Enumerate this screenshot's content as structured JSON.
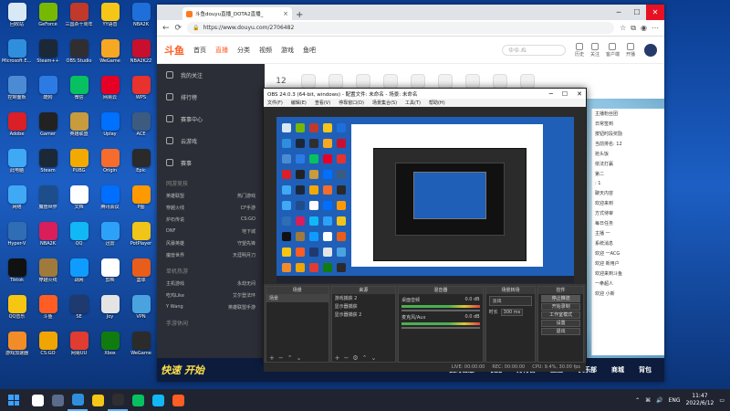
{
  "desktop": {
    "icons": [
      {
        "label": "回收站",
        "color": "#d9e8f5"
      },
      {
        "label": "GeForce",
        "color": "#76b900"
      },
      {
        "label": "三国杀十周年",
        "color": "#c0392b"
      },
      {
        "label": "YY语音",
        "color": "#f5c518"
      },
      {
        "label": "NBA2K",
        "color": "#1e6fd9"
      },
      {
        "label": "Microsoft Edge",
        "color": "#2f8fdc"
      },
      {
        "label": "Steam++",
        "color": "#1b2838"
      },
      {
        "label": "OBS Studio",
        "color": "#302e31"
      },
      {
        "label": "WeGame",
        "color": "#f7a823"
      },
      {
        "label": "NBA2K22",
        "color": "#c8102e"
      },
      {
        "label": "控制面板",
        "color": "#4b8bd4"
      },
      {
        "label": "酷狗",
        "color": "#2c7be5"
      },
      {
        "label": "微信",
        "color": "#07c160"
      },
      {
        "label": "网易云",
        "color": "#e60026"
      },
      {
        "label": "WPS",
        "color": "#e8322d"
      },
      {
        "label": "Adobe",
        "color": "#da1f26"
      },
      {
        "label": "Gamer",
        "color": "#222"
      },
      {
        "label": "英雄联盟",
        "color": "#c89b3c"
      },
      {
        "label": "Uplay",
        "color": "#0070ff"
      },
      {
        "label": "ACE",
        "color": "#3d5a80"
      },
      {
        "label": "此电脑",
        "color": "#3fa9f5"
      },
      {
        "label": "Steam",
        "color": "#1b2838"
      },
      {
        "label": "PUBG",
        "color": "#f2a900"
      },
      {
        "label": "Origin",
        "color": "#f56c2d"
      },
      {
        "label": "Epic",
        "color": "#2a2a2a"
      },
      {
        "label": "网络",
        "color": "#3fa9f5"
      },
      {
        "label": "魔兽世界",
        "color": "#1e4d8b"
      },
      {
        "label": "文档",
        "color": "#ffffff"
      },
      {
        "label": "腾讯会议",
        "color": "#006eff"
      },
      {
        "label": "P图",
        "color": "#ff9900"
      },
      {
        "label": "Hyper-V",
        "color": "#2f6db5"
      },
      {
        "label": "NBA2K",
        "color": "#d81e5b"
      },
      {
        "label": "QQ",
        "color": "#12b7f5"
      },
      {
        "label": "迅雷",
        "color": "#2da1f8"
      },
      {
        "label": "PotPlayer",
        "color": "#f0c419"
      },
      {
        "label": "Tiktok",
        "color": "#111"
      },
      {
        "label": "穿越火线",
        "color": "#a07a3a"
      },
      {
        "label": "战网",
        "color": "#0f9cff"
      },
      {
        "label": "剪映",
        "color": "#ffffff"
      },
      {
        "label": "篮球",
        "color": "#e95d1a"
      },
      {
        "label": "QQ音乐",
        "color": "#f7c613"
      },
      {
        "label": "斗鱼",
        "color": "#ff5d23"
      },
      {
        "label": "SE",
        "color": "#1e3a6e"
      },
      {
        "label": "Joy",
        "color": "#e4e4e4"
      },
      {
        "label": "VPN",
        "color": "#4aa3df"
      },
      {
        "label": "游戏加速器",
        "color": "#f28c28"
      },
      {
        "label": "CS:GO",
        "color": "#f0a500"
      },
      {
        "label": "网易UU",
        "color": "#e03c31"
      },
      {
        "label": "Xbox",
        "color": "#107c10"
      },
      {
        "label": "WeGame",
        "color": "#2b2b2b"
      }
    ]
  },
  "taskbar": {
    "clock_time": "11:47",
    "clock_date": "2022/6/12",
    "lang": "ENG",
    "apps": [
      {
        "name": "search-app",
        "color": "#ffffff"
      },
      {
        "name": "taskview-app",
        "color": "#5a6b8c"
      },
      {
        "name": "edge-app",
        "color": "#2f8fdc"
      },
      {
        "name": "explorer-app",
        "color": "#f5c518"
      },
      {
        "name": "obs-app",
        "color": "#302e31"
      },
      {
        "name": "wechat-app",
        "color": "#07c160"
      },
      {
        "name": "qq-app",
        "color": "#12b7f5"
      },
      {
        "name": "game-app",
        "color": "#ff5d23"
      }
    ]
  },
  "browser": {
    "tab_title": "斗鱼douyu直播_DOTA2直播_",
    "url": "https://www.douyu.com/2706482",
    "nav": {
      "home": "首页",
      "live": "直播",
      "category": "分类",
      "video": "视频",
      "game": "游戏",
      "fish": "鱼吧"
    },
    "search_placeholder": "ゆゆ.ぬ",
    "header_icons": [
      "历史",
      "关注",
      "客户端",
      "开播"
    ],
    "sidebar": {
      "items": [
        "我的关注",
        "排行榜",
        "赛事中心",
        "云游戏",
        "赛事"
      ],
      "section_hot": "网游竞技",
      "sub_rows": [
        [
          "英雄联盟",
          "热门游戏"
        ],
        [
          "穿越火线",
          "CF手游"
        ],
        [
          "炉石传说",
          "CS:GO"
        ],
        [
          "DNF",
          "地下城"
        ],
        [
          "风暴英雄",
          "守望先锋"
        ],
        [
          "魔兽世界",
          "天涯明月刀"
        ]
      ],
      "section_mobile": "单机热游",
      "sub_rows2": [
        [
          "主机游戏",
          "永劫无间"
        ],
        [
          "吃鸡Like",
          "艾尔登法环"
        ],
        [
          "Y Wang",
          "英雄联盟手游"
        ]
      ],
      "section_hand": "手游休闲"
    },
    "strip_badges": [
      "12",
      "",
      "",
      "",
      "",
      "",
      "",
      "",
      "",
      ""
    ],
    "chat_lines": [
      "主播粉丝团",
      "日常签到",
      "按钮时段奖励",
      "当前排名: 12",
      "抢头饭",
      "依法打赢",
      "第二 ",
      ":  1",
      "聊天内容",
      "欢迎来到",
      "方式待审",
      "每日任务",
      "主播  一",
      "系统消息",
      "欢迎 一ACG",
      "欢迎  新用户",
      "欢迎来到斗鱼",
      "一拳超人",
      "欢迎 小新"
    ],
    "game_banner": {
      "slogan": "快速 开始",
      "items": [
        "我的信息",
        "收藏",
        "排行榜",
        "生涯",
        "俱乐部",
        "商城",
        "背包"
      ]
    }
  },
  "obs": {
    "title": "OBS 24.0.3 (64-bit, windows) - 配置文件: 未命名 - 场景: 未命名",
    "menu": [
      "文件(F)",
      "编辑(E)",
      "查看(V)",
      "停靠窗口(D)",
      "场景集合(S)",
      "工具(T)",
      "帮助(H)"
    ],
    "docks": {
      "scenes": {
        "header": "场景",
        "items": [
          "场景"
        ]
      },
      "sources": {
        "header": "来源",
        "items": [
          "游戏捕获 2",
          "显示器捕获",
          "显示器捕获 2"
        ]
      },
      "mixer": {
        "header": "混音器",
        "channels": [
          {
            "name": "桌面音频",
            "level": "0.0 dB"
          },
          {
            "name": "麦克风/Aux",
            "level": "0.0 dB"
          }
        ]
      },
      "transitions": {
        "header": "场景转场",
        "type": "淡出",
        "duration_label": "时长",
        "duration": "300 ms"
      },
      "controls": {
        "header": "控件",
        "buttons": [
          "停止推流",
          "开始录制",
          "工作室模式",
          "设置",
          "退出"
        ]
      }
    },
    "status": [
      "LIVE: 00:00:00",
      "REC: 00:00:00",
      "CPU: 9.4%, 30.00 fps"
    ]
  }
}
